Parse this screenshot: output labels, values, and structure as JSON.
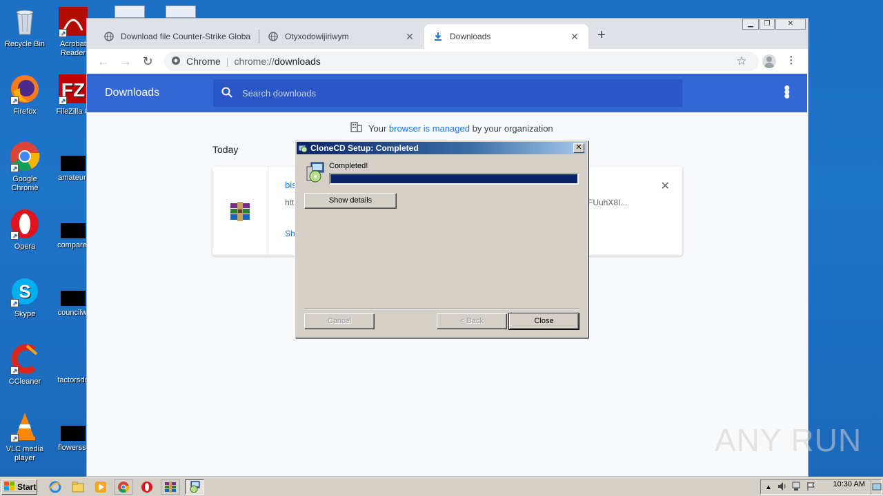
{
  "desktop": {
    "icons": [
      {
        "label": "Recycle Bin"
      },
      {
        "label": "Acrobat Reader"
      },
      {
        "label": "Firefox"
      },
      {
        "label": "FileZilla C"
      },
      {
        "label": "Google Chrome"
      },
      {
        "label": "amateurt"
      },
      {
        "label": "Opera"
      },
      {
        "label": "comparef"
      },
      {
        "label": "Skype"
      },
      {
        "label": "councilwi"
      },
      {
        "label": "CCleaner"
      },
      {
        "label": "factorsdo"
      },
      {
        "label": "VLC media player"
      },
      {
        "label": "flowersst"
      }
    ]
  },
  "chrome": {
    "tabs": [
      {
        "title": "Download file Counter-Strike Global O"
      },
      {
        "title": "Otyxodowijiriwym"
      },
      {
        "title": "Downloads"
      }
    ],
    "omnibox": {
      "site_label": "Chrome",
      "url_scheme": "chrome://",
      "url_host": "downloads"
    }
  },
  "downloads": {
    "title": "Downloads",
    "search_placeholder": "Search downloads",
    "managed": {
      "prefix": "Your",
      "link": "browser is managed",
      "suffix": "by your organization"
    },
    "section": "Today",
    "item": {
      "name": "bis",
      "url": "htt",
      "url_tail": "FUuhX8I...",
      "action": "Sh"
    }
  },
  "setup_dialog": {
    "title": "CloneCD Setup: Completed",
    "status": "Completed!",
    "progress": 1.0,
    "show_details": "Show details",
    "cancel": "Cancel",
    "back": "< Back",
    "close": "Close"
  },
  "watermark": "ANY RUN",
  "taskbar": {
    "start": "Start",
    "clock": "10:30 AM"
  }
}
